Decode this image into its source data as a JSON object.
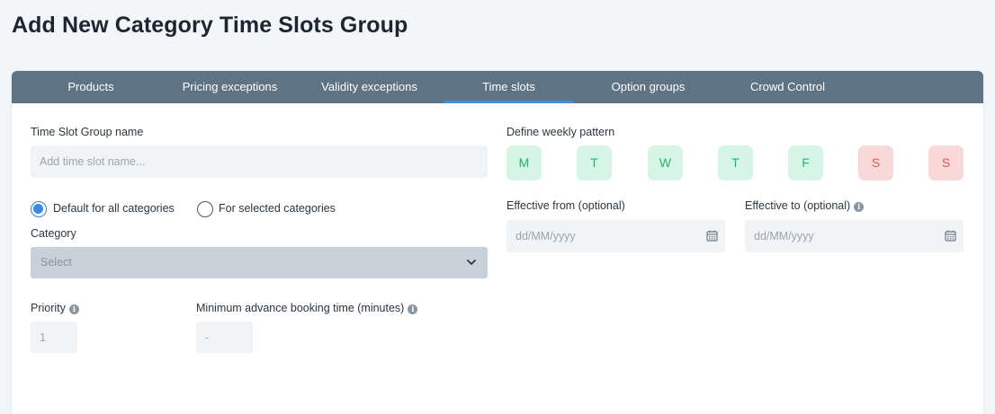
{
  "page": {
    "title": "Add New Category Time Slots Group"
  },
  "tabs": [
    {
      "label": "Products"
    },
    {
      "label": "Pricing exceptions"
    },
    {
      "label": "Validity exceptions"
    },
    {
      "label": "Time slots",
      "active": true
    },
    {
      "label": "Option groups"
    },
    {
      "label": "Crowd Control"
    }
  ],
  "form": {
    "name_label": "Time Slot Group name",
    "name_placeholder": "Add time slot name...",
    "radio_default": "Default for all categories",
    "radio_selected": "For selected categories",
    "radio_default_checked": true,
    "category_label": "Category",
    "category_value": "Select",
    "priority_label": "Priority",
    "priority_value": "1",
    "min_booking_label": "Minimum advance booking time (minutes)",
    "min_booking_value": "-"
  },
  "weekly": {
    "label": "Define weekly pattern",
    "days": [
      "M",
      "T",
      "W",
      "T",
      "F",
      "S",
      "S"
    ],
    "weekday_color": "#27b36a",
    "weekend_color": "#e05858"
  },
  "effective": {
    "from_label": "Effective from (optional)",
    "to_label": "Effective to (optional)",
    "from_placeholder": "dd/MM/yyyy",
    "to_placeholder": "dd/MM/yyyy"
  },
  "icons": {
    "info": "info-icon",
    "calendar": "calendar-icon",
    "chevron": "chevron-down-icon"
  },
  "colors": {
    "tab_bar": "#5e7383",
    "tab_active_underline": "#3d8de3",
    "radio_accent": "#3b8ae6"
  }
}
